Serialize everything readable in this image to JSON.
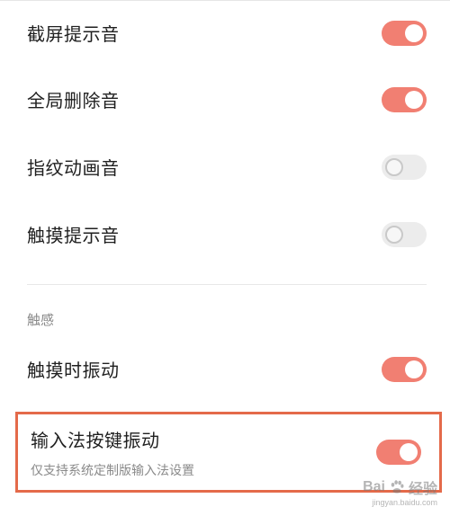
{
  "settings": [
    {
      "label": "截屏提示音",
      "on": true
    },
    {
      "label": "全局删除音",
      "on": true
    },
    {
      "label": "指纹动画音",
      "on": false
    },
    {
      "label": "触摸提示音",
      "on": false
    }
  ],
  "haptics": {
    "section_title": "触感",
    "items": [
      {
        "label": "触摸时振动",
        "on": true
      }
    ],
    "highlighted": {
      "label": "输入法按键振动",
      "description": "仅支持系统定制版输入法设置",
      "on": true
    }
  },
  "watermark": {
    "brand_text": "Bai",
    "brand_suffix": "经验",
    "sub_text": "jingyan.baidu.com"
  },
  "colors": {
    "toggle_on": "#f17f72",
    "toggle_off": "#ececec",
    "highlight_border": "#e46a4a"
  }
}
